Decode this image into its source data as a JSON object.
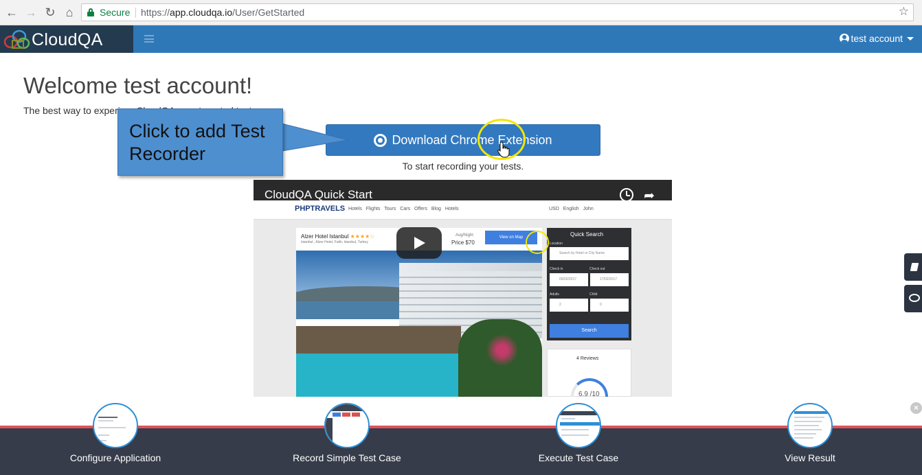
{
  "browser": {
    "secure_label": "Secure",
    "url_scheme": "https://",
    "url_host": "app.cloudqa.io",
    "url_path": "/User/GetStarted"
  },
  "app": {
    "brand_name": "CloudQA",
    "account_label": "test account"
  },
  "content": {
    "welcome_title": "Welcome test account!",
    "subtitle": "The best way to experie... CloudQA ... automated test.",
    "download_button": "Download Chrome Extension",
    "start_text": "To start recording your tests."
  },
  "callout": {
    "text": "Click to add Test Recorder"
  },
  "video": {
    "title": "CloudQA Quick Start",
    "site_logo": "PHPTRAVELS",
    "site_nav": "Hotels Flights Tours Cars Offers Blog Hotels",
    "site_right": "USD English John",
    "hotel_name": "Alzer Hotel Istanbul",
    "hotel_stars": "★★★★☆",
    "hotel_address": "Istanbul , Alzer Hotel, Fatih, Istanbul, Turkey",
    "avg_night": "Avg/Night",
    "price": "Price $70",
    "map_button": "View on Map",
    "quick_search": "Quick Search",
    "location_label": "Location",
    "location_placeholder": "Search by Hotel or City Name",
    "checkin_label": "Check in",
    "checkout_label": "Check out",
    "checkin_value": "09/02/2017",
    "checkout_value": "17/02/2017",
    "adults_label": "Adults",
    "child_label": "Child",
    "adults_value": "2",
    "child_value": "0",
    "search_button": "Search",
    "reviews": "4 Reviews",
    "score": "6.9 /10"
  },
  "steps": [
    {
      "label": "Configure Application"
    },
    {
      "label": "Record Simple Test Case"
    },
    {
      "label": "Execute Test Case"
    },
    {
      "label": "View Result"
    }
  ],
  "colors": {
    "header_blue": "#2f78b8",
    "brand_dark": "#243a4f",
    "button_blue": "#3379bf",
    "footer_dark": "#363c4a",
    "footer_accent": "#e0535a",
    "callout_blue": "#4e8fd0",
    "highlight_yellow": "#f3e600"
  },
  "icons": {
    "back": "arrow-left-icon",
    "forward": "arrow-right-icon",
    "reload": "reload-icon",
    "home": "home-icon",
    "lock": "lock-icon",
    "star": "star-icon",
    "menu": "hamburger-icon",
    "user": "user-icon",
    "chrome": "chrome-icon",
    "play": "play-icon",
    "book": "book-icon",
    "chat": "chat-icon",
    "close": "close-icon"
  }
}
